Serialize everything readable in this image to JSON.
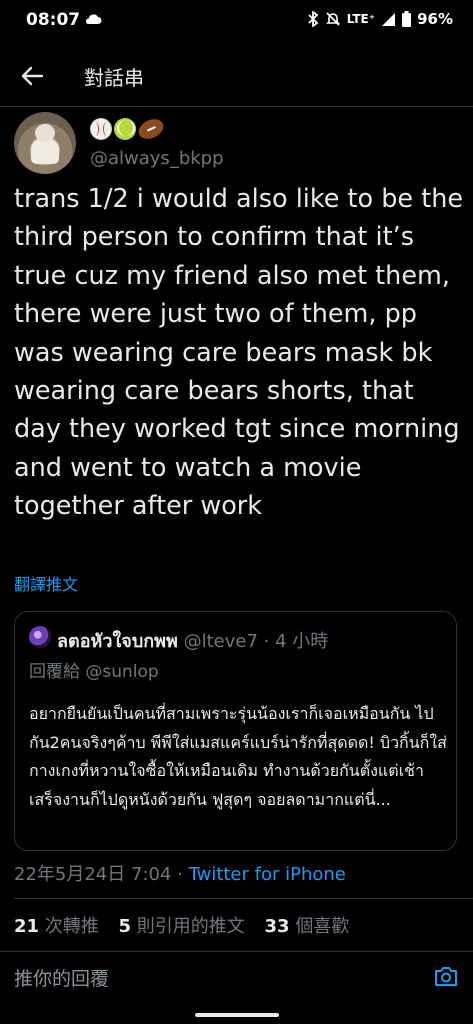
{
  "status_bar": {
    "time": "08:07",
    "network": "LTE⁺",
    "battery": "96%"
  },
  "header": {
    "title": "對話串"
  },
  "tweet": {
    "handle": "@always_bkpp",
    "text": "trans 1/2 i would also like to be the third person to confirm that it’s true cuz my friend also met them, there were just two of them, pp was wearing care bears mask bk wearing care bears shorts, that day they worked tgt since morning and went to watch a movie together after work",
    "translate_label": "翻譯推文",
    "timestamp": "22年5月24日 7:04 · ",
    "source": "Twitter for iPhone"
  },
  "quoted_tweet": {
    "name": "ลตอหัวใจบกพพ",
    "handle_time": " @lteve7 · 4 小時",
    "replying_to": "回覆給 @sunlop",
    "text": "อยากยืนยันเป็นคนที่สามเพราะรุ่นน้องเราก็เจอเหมือนกัน ไปกัน2คนจริงๆค้าบ พีพีใส่แมสแคร์แบร์น่ารักที่สุดดด! บิวกิ้นก็ใส่กางเกงที่หวานใจซื้อให้เหมือนเดิม ทำงานด้วยกันตั้งแต่เช้าเสร็จงานก็ไปดูหนังด้วยกัน ฟูสุดๆ จอยลดามากแต่นี่..."
  },
  "stats": {
    "retweets": "21",
    "retweets_label": " 次轉推",
    "quotes": "5",
    "quotes_label": " 則引用的推文",
    "likes": "33",
    "likes_label": " 個喜歡"
  },
  "reply": {
    "placeholder": "推你的回覆"
  },
  "colors": {
    "background": "#000000",
    "text": "#e7e9ea",
    "secondary": "#71767b",
    "link": "#1d9bf0",
    "border": "#2f3336"
  }
}
